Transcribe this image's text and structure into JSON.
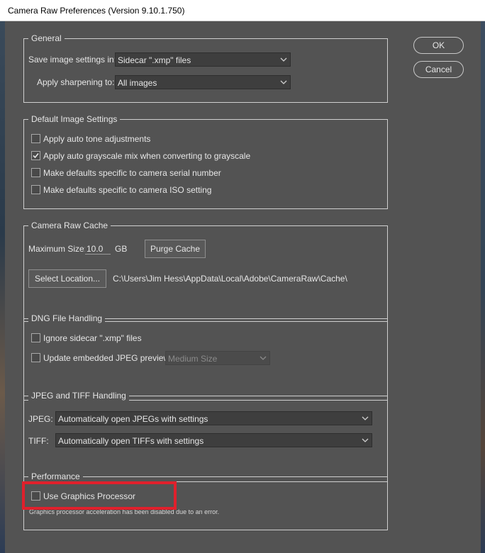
{
  "window": {
    "title": "Camera Raw Preferences  (Version 9.10.1.750)"
  },
  "buttons": {
    "ok": "OK",
    "cancel": "Cancel"
  },
  "general": {
    "legend": "General",
    "save_label": "Save image settings in:",
    "save_value": "Sidecar \".xmp\" files",
    "sharpen_label": "Apply sharpening to:",
    "sharpen_value": "All images"
  },
  "default_image": {
    "legend": "Default Image Settings",
    "options": [
      {
        "label": "Apply auto tone adjustments",
        "checked": false
      },
      {
        "label": "Apply auto grayscale mix when converting to grayscale",
        "checked": true
      },
      {
        "label": "Make defaults specific to camera serial number",
        "checked": false
      },
      {
        "label": "Make defaults specific to camera ISO setting",
        "checked": false
      }
    ]
  },
  "cache": {
    "legend": "Camera Raw Cache",
    "max_size_label": "Maximum Size:",
    "max_size_value": "10.0",
    "unit": "GB",
    "purge_label": "Purge Cache",
    "select_location_label": "Select Location...",
    "path": "C:\\Users\\Jim Hess\\AppData\\Local\\Adobe\\CameraRaw\\Cache\\"
  },
  "dng": {
    "legend": "DNG File Handling",
    "ignore_label": "Ignore sidecar \".xmp\" files",
    "ignore_checked": false,
    "update_label": "Update embedded JPEG previews:",
    "update_checked": false,
    "preview_size": "Medium Size"
  },
  "jpeg_tiff": {
    "legend": "JPEG and TIFF Handling",
    "jpeg_label": "JPEG:",
    "jpeg_value": "Automatically open JPEGs with settings",
    "tiff_label": "TIFF:",
    "tiff_value": "Automatically open TIFFs with settings"
  },
  "performance": {
    "legend": "Performance",
    "gpu_label": "Use Graphics Processor",
    "gpu_checked": false,
    "note": "Graphics processor acceleration has been disabled due to an error."
  },
  "colors": {
    "highlight": "#e0202c",
    "background": "#535353"
  }
}
